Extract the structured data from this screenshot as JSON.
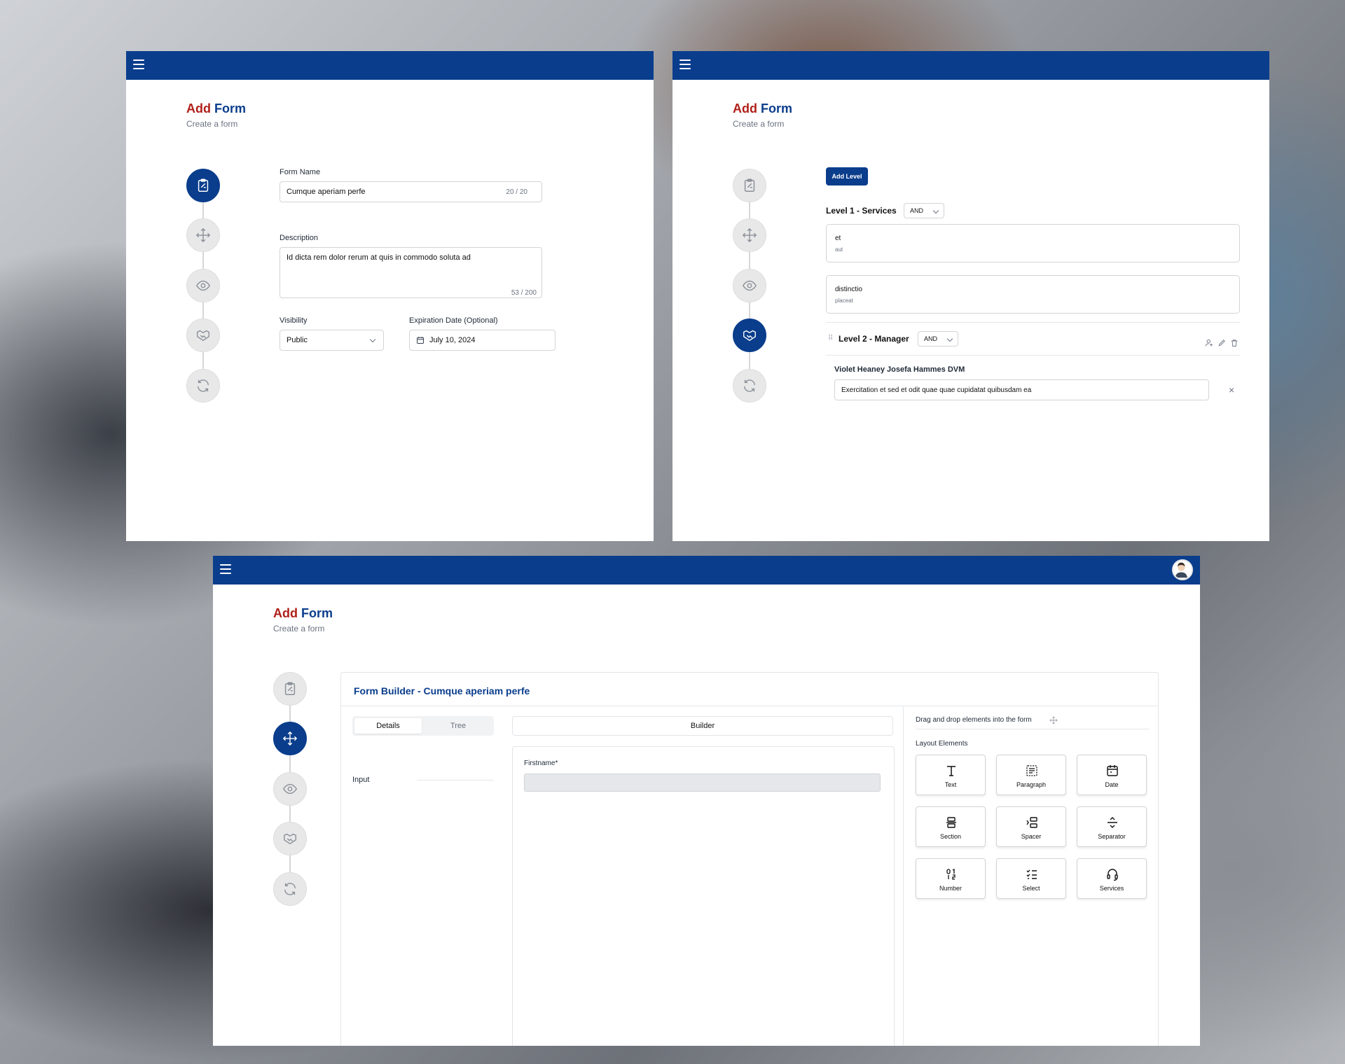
{
  "screens": [
    {
      "title_add": "Add",
      "title_form": "Form",
      "subtitle": "Create a form",
      "form_name_label": "Form Name",
      "form_name_value": "Cumque aperiam perfe",
      "form_name_counter": "20 / 20",
      "description_label": "Description",
      "description_value": "Id dicta rem dolor rerum at quis in commodo soluta ad",
      "description_counter": "53 / 200",
      "visibility_label": "Visibility",
      "visibility_value": "Public",
      "expiration_label": "Expiration Date (Optional)",
      "expiration_value": "July 10, 2024",
      "active_step": 1
    },
    {
      "title_add": "Add",
      "title_form": "Form",
      "subtitle": "Create a form",
      "add_level_button": "Add Level",
      "level1_title": "Level 1 - Services",
      "level1_operator": "AND",
      "level1_items": [
        {
          "title": "et",
          "subtitle": "aut"
        },
        {
          "title": "distinctio",
          "subtitle": "placeat"
        }
      ],
      "level2_title": "Level 2 - Manager",
      "level2_operator": "AND",
      "manager_name": "Violet Heaney Josefa Hammes DVM",
      "manager_note": "Exercitation et sed et odit quae quae cupidatat quibusdam ea",
      "active_step": 4
    },
    {
      "title_add": "Add",
      "title_form": "Form",
      "subtitle": "Create a form",
      "builder_title": "Form Builder - Cumque aperiam perfe",
      "tabs": [
        "Details",
        "Tree"
      ],
      "tree_item": "Input",
      "builder_tab": "Builder",
      "firstname_label": "Firstname*",
      "drag_hint": "Drag and drop elements into the form",
      "layout_elements_label": "Layout Elements",
      "elements": [
        "Text",
        "Paragraph",
        "Date",
        "Section",
        "Spacer",
        "Separator",
        "Number",
        "Select",
        "Services"
      ],
      "active_step": 2
    }
  ],
  "colors": {
    "primary": "#0a3d8c",
    "accent_red": "#b0201a",
    "step_inactive": "#e8e8e8"
  },
  "step_icons": [
    "clipboard-icon",
    "move-icon",
    "eye-icon",
    "handshake-icon",
    "refresh-icon"
  ]
}
